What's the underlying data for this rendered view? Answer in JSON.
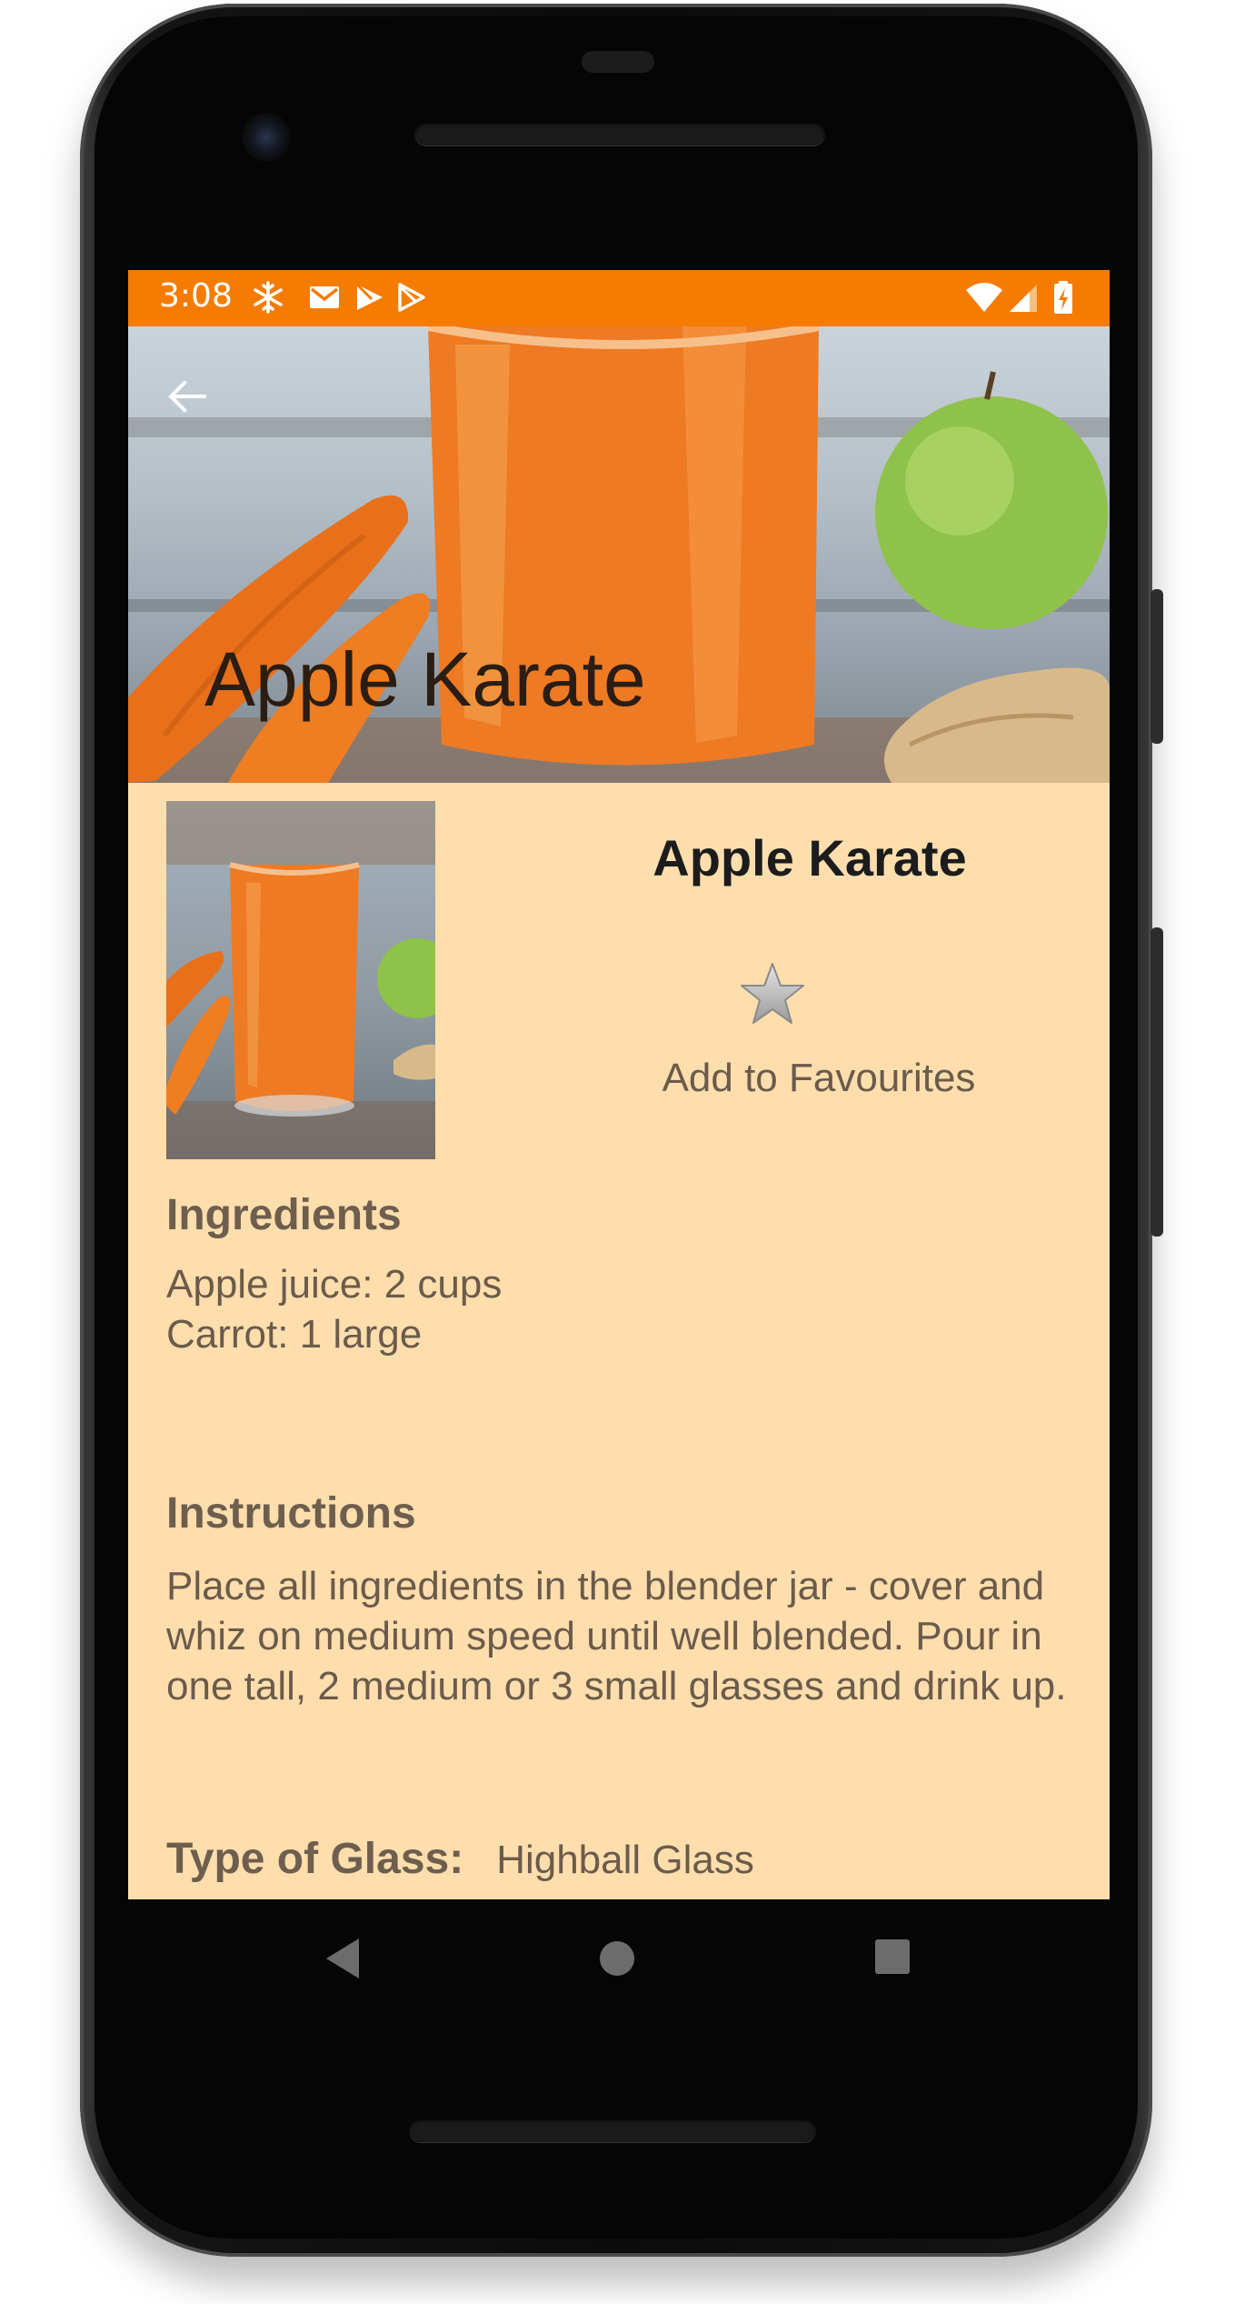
{
  "status_bar": {
    "time": "3:08",
    "left_icons": [
      "snowflake-icon",
      "gmail-icon",
      "play-store-icon",
      "play-store-outline-icon"
    ],
    "right_icons": [
      "wifi-icon",
      "signal-icon",
      "battery-charging-icon"
    ]
  },
  "header": {
    "title": "Apple Karate",
    "back_icon": "arrow-back-icon"
  },
  "drink": {
    "name": "Apple Karate",
    "favourite_label": "Add to Favourites",
    "favourite_icon": "star-icon"
  },
  "ingredients": {
    "heading": "Ingredients",
    "items": [
      "Apple juice: 2 cups",
      "Carrot: 1 large"
    ]
  },
  "instructions": {
    "heading": "Instructions",
    "text": "Place all ingredients in the blender jar - cover and whiz on medium speed until well blended. Pour in one tall, 2 medium or 3 small glasses and drink up."
  },
  "glass": {
    "label": "Type of Glass:",
    "value": "Highball Glass"
  },
  "nav": {
    "icons": [
      "back-triangle-icon",
      "home-circle-icon",
      "recents-square-icon"
    ]
  },
  "colors": {
    "status_bar": "#f57c00",
    "content_background": "#ffdead",
    "text_primary": "#1c1c1c",
    "text_secondary": "#6b5b4b"
  }
}
